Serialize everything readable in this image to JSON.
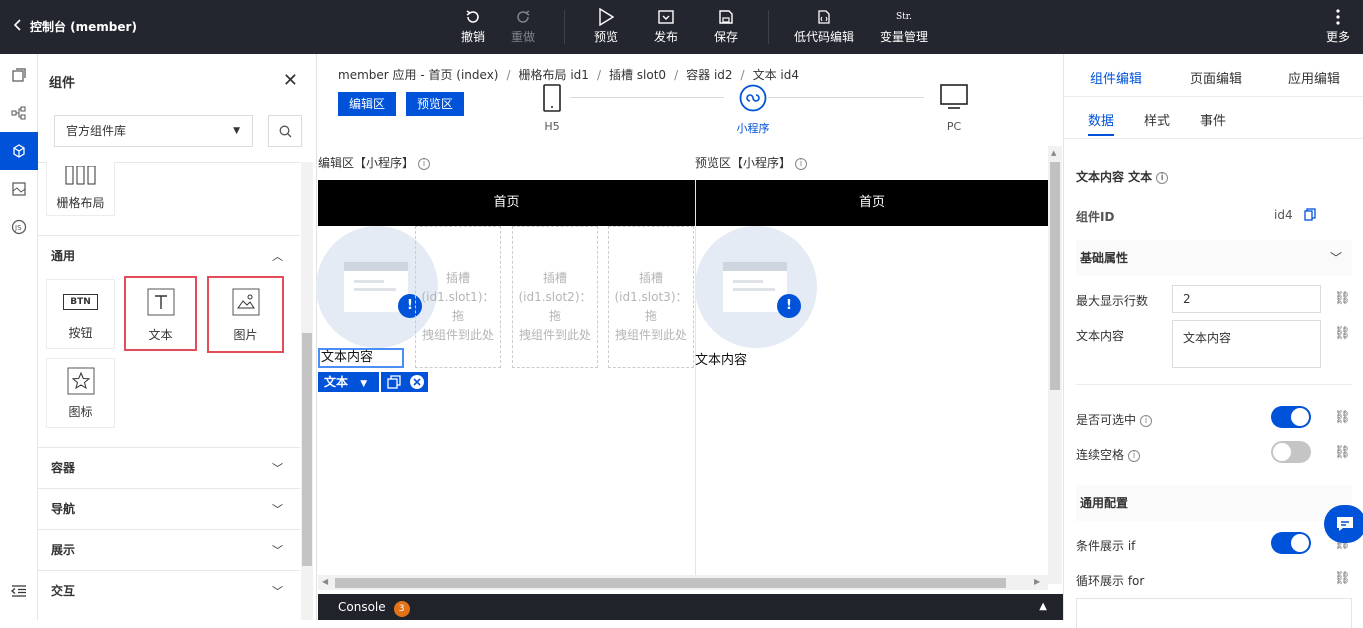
{
  "header": {
    "back_label": "控制台 (member)",
    "toolbar": [
      {
        "id": "undo",
        "label": "撤销",
        "icon": "undo-icon",
        "disabled": false
      },
      {
        "id": "redo",
        "label": "重做",
        "icon": "redo-icon",
        "disabled": true
      },
      {
        "id": "preview",
        "label": "预览",
        "icon": "play-icon",
        "disabled": false
      },
      {
        "id": "publish",
        "label": "发布",
        "icon": "publish-icon",
        "disabled": false
      },
      {
        "id": "save",
        "label": "保存",
        "icon": "save-icon",
        "disabled": false
      },
      {
        "id": "lowcode",
        "label": "低代码编辑",
        "icon": "code-file-icon",
        "disabled": false
      },
      {
        "id": "vars",
        "label": "变量管理",
        "icon_text": "Str.",
        "disabled": false
      },
      {
        "id": "more",
        "label": "更多",
        "icon": "more-vertical-icon",
        "disabled": false
      }
    ]
  },
  "left_panel": {
    "title": "组件",
    "library_select": "官方组件库",
    "partial_tile": "栅格布局",
    "section_general": "通用",
    "tiles": {
      "button": {
        "label": "按钮",
        "icon_text": "BTN"
      },
      "text": {
        "label": "文本"
      },
      "image": {
        "label": "图片"
      },
      "icon": {
        "label": "图标"
      }
    },
    "sections": [
      "容器",
      "导航",
      "展示",
      "交互"
    ]
  },
  "center": {
    "breadcrumb": [
      "member 应用 - 首页 (index)",
      "栅格布局 id1",
      "插槽 slot0",
      "容器 id2",
      "文本 id4"
    ],
    "edit_btn": "编辑区",
    "preview_btn": "预览区",
    "devices": [
      "H5",
      "小程序",
      "PC"
    ],
    "edit_area_label": "编辑区【小程序】",
    "preview_area_label": "预览区【小程序】",
    "page_title": "首页",
    "slots": [
      {
        "title": "插槽",
        "line2": "(id1.slot1)：拖",
        "line3": "拽组件到此处"
      },
      {
        "title": "插槽",
        "line2": "(id1.slot2)：拖",
        "line3": "拽组件到此处"
      },
      {
        "title": "插槽",
        "line2": "(id1.slot3)：拖",
        "line3": "拽组件到此处"
      }
    ],
    "text_content": "文本内容",
    "selected_tag": "文本",
    "console_label": "Console",
    "console_count": "3"
  },
  "right_panel": {
    "tabs": [
      "组件编辑",
      "页面编辑",
      "应用编辑"
    ],
    "subtabs": [
      "数据",
      "样式",
      "事件"
    ],
    "component_title": "文本内容 文本",
    "component_id_label": "组件ID",
    "component_id_value": "id4",
    "basic_props": "基础属性",
    "max_lines_label": "最大显示行数",
    "max_lines_value": "2",
    "text_label": "文本内容",
    "text_value": "文本内容",
    "selectable_label": "是否可选中",
    "selectable_on": true,
    "spaces_label": "连续空格",
    "spaces_on": false,
    "common_config": "通用配置",
    "if_label": "条件展示 if",
    "if_on": true,
    "for_label": "循环展示 for"
  },
  "colors": {
    "accent": "#0052d9",
    "topbar": "#23262e",
    "highlight": "#e34d59"
  }
}
